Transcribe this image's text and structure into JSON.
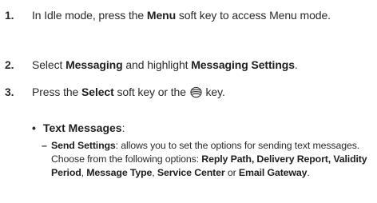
{
  "steps": [
    {
      "number": "1.",
      "parts": [
        {
          "t": "In Idle mode, press the ",
          "b": false
        },
        {
          "t": "Menu",
          "b": true
        },
        {
          "t": " soft key to access Menu mode.",
          "b": false
        }
      ]
    },
    {
      "number": "2.",
      "parts": [
        {
          "t": "Select ",
          "b": false
        },
        {
          "t": "Messaging",
          "b": true
        },
        {
          "t": " and highlight ",
          "b": false
        },
        {
          "t": "Messaging Settings",
          "b": true
        },
        {
          "t": ".",
          "b": false
        }
      ]
    },
    {
      "number": "3.",
      "parts": [
        {
          "t": "Press the ",
          "b": false
        },
        {
          "t": "Select",
          "b": true
        },
        {
          "t": " soft key or the ",
          "b": false
        },
        {
          "icon": "center-select-key-icon"
        },
        {
          "t": " key.",
          "b": false
        }
      ]
    }
  ],
  "bullet": {
    "symbol": "•",
    "label": "Text Messages",
    "suffix": ":"
  },
  "sub_item": {
    "symbol": "–",
    "label": "Send Settings",
    "parts": [
      {
        "t": ": allows you to set the options for sending text messages. Choose from the following options: ",
        "b": false
      },
      {
        "t": "Reply Path, Delivery Report, Validity Period",
        "b": true
      },
      {
        "t": ", ",
        "b": false
      },
      {
        "t": "Message Type",
        "b": true
      },
      {
        "t": ", ",
        "b": false
      },
      {
        "t": "Service Center",
        "b": true
      },
      {
        "t": " or ",
        "b": false
      },
      {
        "t": "Email Gateway",
        "b": true
      },
      {
        "t": ".",
        "b": false
      }
    ]
  },
  "colors": {
    "text": "#2a2a2a",
    "icon": "#333333"
  }
}
